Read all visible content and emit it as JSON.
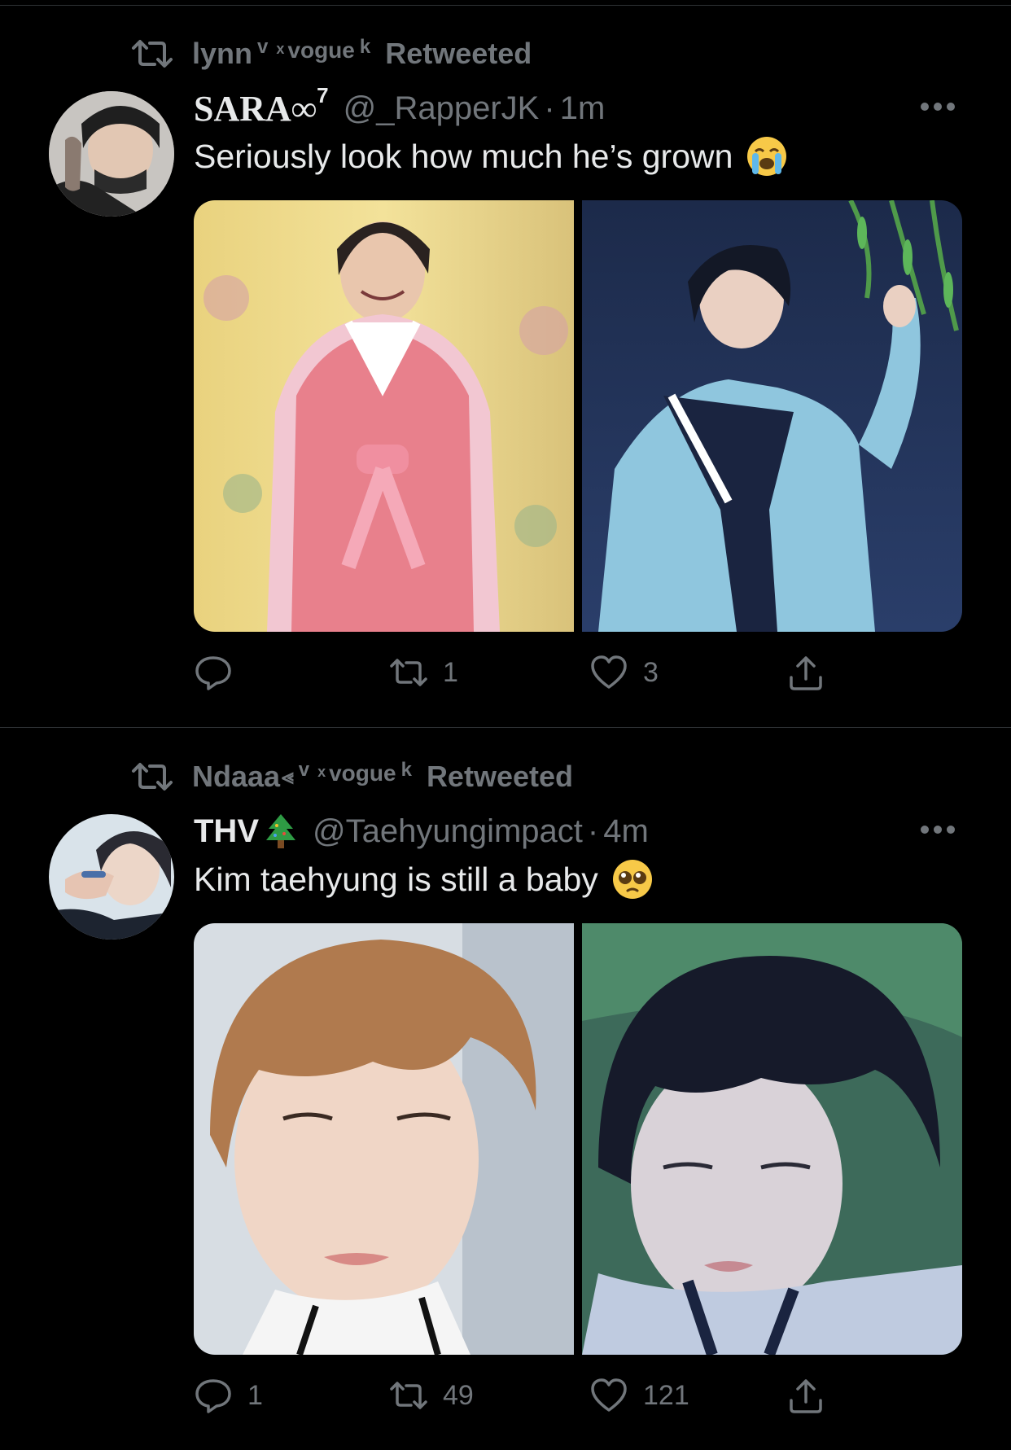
{
  "tweets": [
    {
      "retweeted_by": {
        "name": "lynn",
        "sup_v": "v",
        "sup_x": "x",
        "middle": "vogue",
        "sup_k": "k",
        "label": "Retweeted"
      },
      "author": {
        "name": "SARA∞",
        "name_sup": "7",
        "handle": "@_RapperJK",
        "separator": "·",
        "time": "1m"
      },
      "text": "Seriously look how much he’s grown",
      "emoji": "loudly-crying-face",
      "media": [
        "photo-pink-hanbok",
        "photo-blue-hanbok"
      ],
      "stats": {
        "replies": "",
        "retweets": "1",
        "likes": "3"
      }
    },
    {
      "retweeted_by": {
        "name": "Ndaaa",
        "name_suffix": "⪡",
        "sup_v": "v",
        "sup_x": "x",
        "middle": "vogue",
        "sup_k": "k",
        "label": "Retweeted"
      },
      "author": {
        "name": "THV",
        "name_emoji": "🎄",
        "handle": "@Taehyungimpact",
        "separator": "·",
        "time": "4m"
      },
      "text": "Kim taehyung is still a baby",
      "emoji": "pleading-face",
      "media": [
        "photo-brown-hair",
        "photo-dark-hair"
      ],
      "stats": {
        "replies": "1",
        "retweets": "49",
        "likes": "121"
      }
    }
  ],
  "colors": {
    "background": "#000000",
    "text": "#e7e9ea",
    "secondary": "#71767b",
    "divider": "#2f3336"
  }
}
